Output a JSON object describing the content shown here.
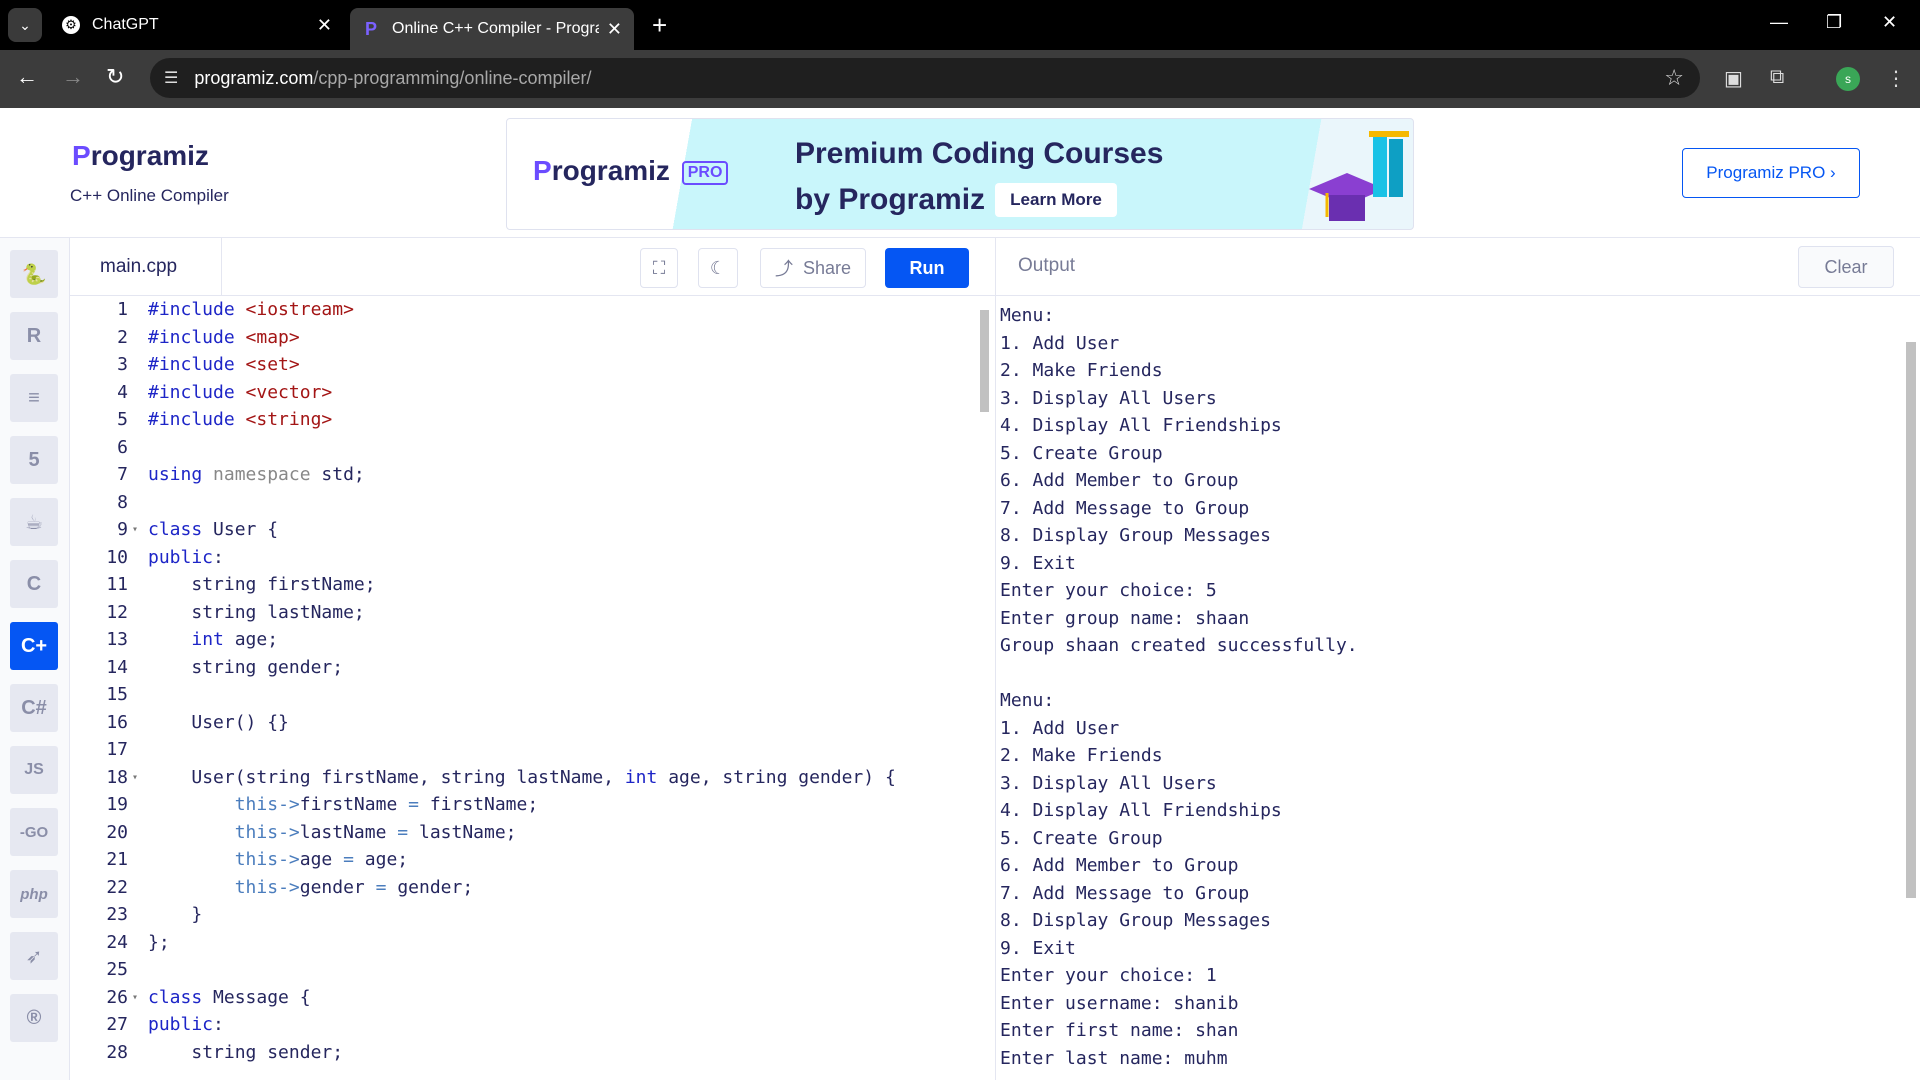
{
  "browser": {
    "tabs": [
      {
        "title": "ChatGPT",
        "favicon": "chatgpt-icon"
      },
      {
        "title": "Online C++ Compiler - Program",
        "favicon": "programiz-icon"
      }
    ],
    "url_host": "programiz.com",
    "url_path": "/cpp-programming/online-compiler/",
    "profile_initial": "s"
  },
  "header": {
    "logo_p": "P",
    "logo_rest": "rogramiz",
    "subtitle": "C++ Online Compiler",
    "banner": {
      "logo_p": "P",
      "logo_rest": "rogramiz",
      "pro_badge": "PRO",
      "line1": "Premium Coding Courses",
      "line2": "by Programiz",
      "cta": "Learn More"
    },
    "pro_button": "Programiz PRO ›"
  },
  "editor": {
    "filename": "main.cpp",
    "share_label": "Share",
    "run_label": "Run"
  },
  "output": {
    "title": "Output",
    "clear_label": "Clear",
    "lines": [
      "Menu:",
      "1. Add User",
      "2. Make Friends",
      "3. Display All Users",
      "4. Display All Friendships",
      "5. Create Group",
      "6. Add Member to Group",
      "7. Add Message to Group",
      "8. Display Group Messages",
      "9. Exit",
      "Enter your choice: 5",
      "Enter group name: shaan",
      "Group shaan created successfully.",
      "",
      "Menu:",
      "1. Add User",
      "2. Make Friends",
      "3. Display All Users",
      "4. Display All Friendships",
      "5. Create Group",
      "6. Add Member to Group",
      "7. Add Message to Group",
      "8. Display Group Messages",
      "9. Exit",
      "Enter your choice: 1",
      "Enter username: shanib",
      "Enter first name: shan",
      "Enter last name: muhm"
    ]
  },
  "code": {
    "l1": "1",
    "c1a": "#include",
    "c1b": "<iostream>",
    "l2": "2",
    "c2a": "#include",
    "c2b": "<map>",
    "l3": "3",
    "c3a": "#include",
    "c3b": "<set>",
    "l4": "4",
    "c4a": "#include",
    "c4b": "<vector>",
    "l5": "5",
    "c5a": "#include",
    "c5b": "<string>",
    "l6": "6",
    "l7": "7",
    "c7a": "using",
    "c7b": "namespace",
    "c7c": "std;",
    "l8": "8",
    "l9": "9",
    "c9a": "class",
    "c9b": "User {",
    "l10": "10",
    "c10a": "public",
    "l11": "11",
    "c11": "string firstName;",
    "l12": "12",
    "c12": "string lastName;",
    "l13": "13",
    "c13a": "int",
    "c13b": "age;",
    "l14": "14",
    "c14": "string gender;",
    "l15": "15",
    "l16": "16",
    "c16": "User() {}",
    "l17": "17",
    "l18": "18",
    "c18a": "User(string firstName, string lastName,",
    "c18b": "int",
    "c18c": "age, string gender) {",
    "l19": "19",
    "c19a": "this",
    "c19b": "->",
    "c19c": "firstName",
    "c19d": "=",
    "c19e": "firstName;",
    "l20": "20",
    "c20a": "this",
    "c20b": "->",
    "c20c": "lastName",
    "c20d": "=",
    "c20e": "lastName;",
    "l21": "21",
    "c21a": "this",
    "c21b": "->",
    "c21c": "age",
    "c21d": "=",
    "c21e": "age;",
    "l22": "22",
    "c22a": "this",
    "c22b": "->",
    "c22c": "gender",
    "c22d": "=",
    "c22e": "gender;",
    "l23": "23",
    "c23": "}",
    "l24": "24",
    "c24": "};",
    "l25": "25",
    "l26": "26",
    "c26a": "class",
    "c26b": "Message {",
    "l27": "27",
    "c27a": "public",
    "l28": "28",
    "c28": "string sender;"
  },
  "sidebar": {
    "languages": [
      "python-icon",
      "r-icon",
      "sql-icon",
      "html-icon",
      "java-icon",
      "c-icon",
      "cpp-icon",
      "csharp-icon",
      "js-icon",
      "go-icon",
      "php-icon",
      "swift-icon",
      "rust-icon"
    ],
    "labels": {
      "js": "JS",
      "go": "-GO",
      "php": "php"
    }
  },
  "colors": {
    "accent": "#0556f3",
    "brand_purple": "#6b4cff",
    "text": "#25265e"
  }
}
